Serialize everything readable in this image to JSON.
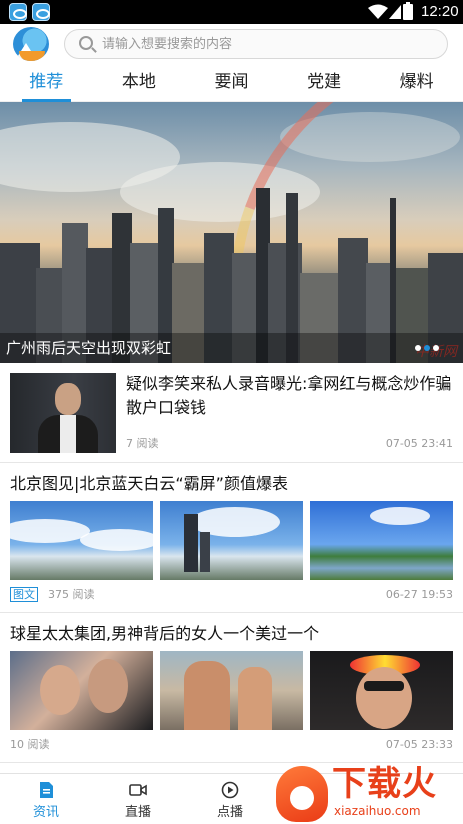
{
  "status_bar": {
    "time": "12:20"
  },
  "search": {
    "placeholder": "请输入想要搜索的内容"
  },
  "tabs": [
    {
      "label": "推荐",
      "active": true
    },
    {
      "label": "本地",
      "active": false
    },
    {
      "label": "要闻",
      "active": false
    },
    {
      "label": "党建",
      "active": false
    },
    {
      "label": "爆料",
      "active": false
    }
  ],
  "hero": {
    "caption": "广州雨后天空出现双彩虹",
    "watermark": "中新网",
    "page_count": 3,
    "current_page": 2
  },
  "news": [
    {
      "title": "疑似李笑来私人录音曝光:拿网红与概念炒作骗散户口袋钱",
      "reads": "7 阅读",
      "time": "07-05 23:41"
    },
    {
      "title": "北京图见|北京蓝天白云“霸屏”颜值爆表",
      "badge": "图文",
      "reads": "375 阅读",
      "time": "06-27 19:53"
    },
    {
      "title": "球星太太集团,男神背后的女人一个美过一个",
      "reads": "10 阅读",
      "time": "07-05 23:33"
    }
  ],
  "bottom_nav": [
    {
      "label": "资讯",
      "icon": "document-icon",
      "active": true
    },
    {
      "label": "直播",
      "icon": "video-camera-icon",
      "active": false
    },
    {
      "label": "点播",
      "icon": "play-circle-icon",
      "active": false
    }
  ],
  "watermark": {
    "text": "下载火",
    "url": "xiazaihuo.com"
  },
  "colors": {
    "accent": "#1f8fd8",
    "watermark": "#e8401a"
  }
}
